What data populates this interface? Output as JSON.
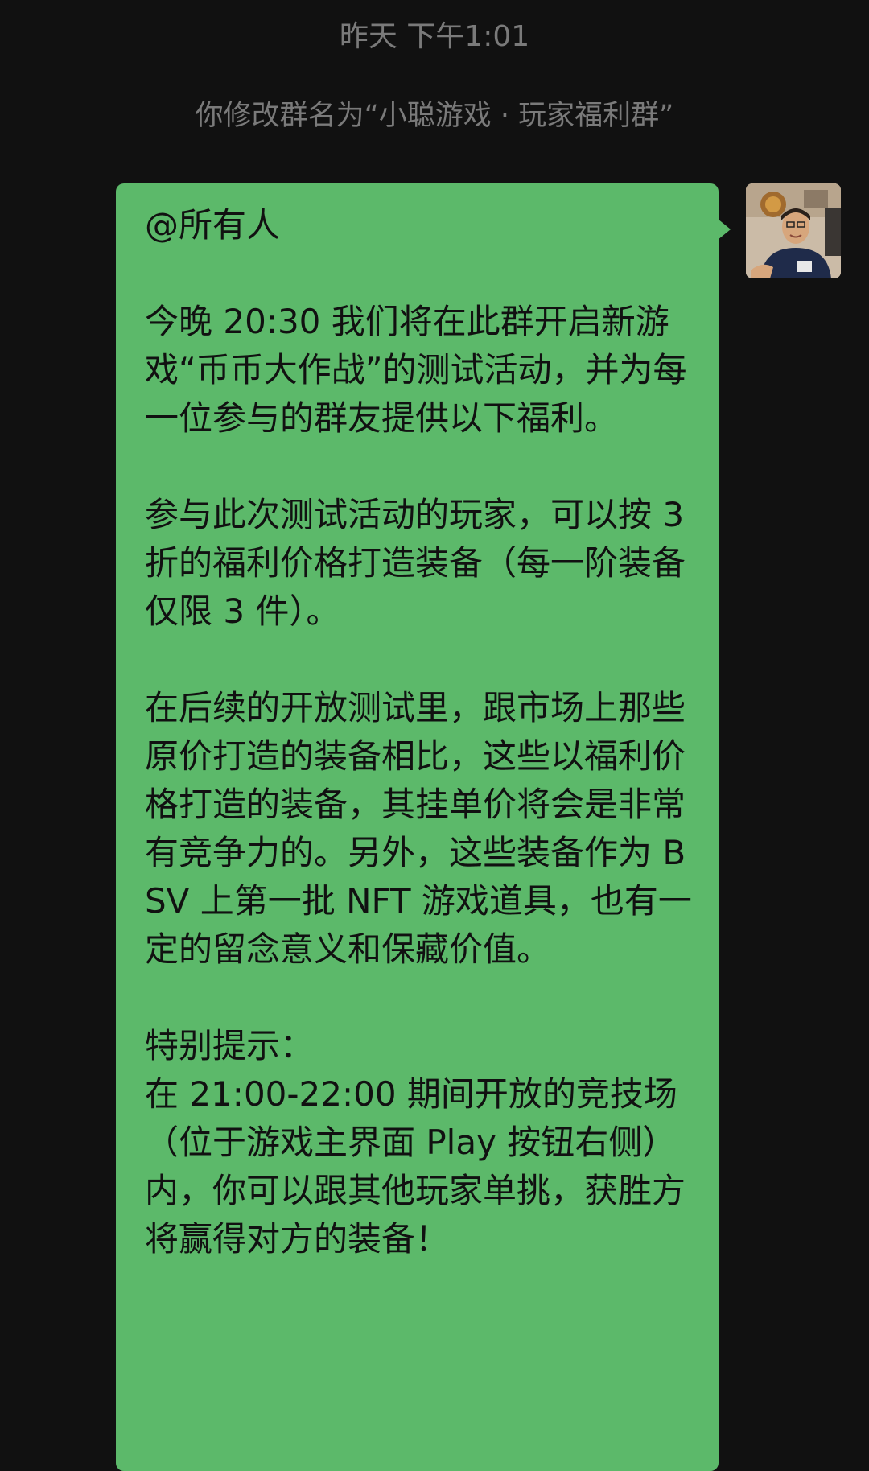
{
  "chat": {
    "timestamp": "昨天 下午1:01",
    "system_notice": "你修改群名为“小聪游戏 · 玩家福利群”",
    "message": {
      "paragraphs": [
        "@所有人",
        "今晚 20:30 我们将在此群开启新游戏“币币大作战”的测试活动，并为每一位参与的群友提供以下福利。",
        "参与此次测试活动的玩家，可以按 3 折的福利价格打造装备（每一阶装备仅限 3 件）。",
        "在后续的开放测试里，跟市场上那些原价打造的装备相比，这些以福利价格打造的装备，其挂单价将会是非常有竞争力的。另外，这些装备作为 BSV 上第一批 NFT 游戏道具，也有一定的留念意义和保藏价值。",
        "特别提示：\n在 21:00-22:00 期间开放的竞技场（位于游戏主界面 Play 按钮右侧）内，你可以跟其他玩家单挑，获胜方将赢得对方的装备！"
      ],
      "bubble_color": "#5cb96a",
      "sender_avatar": "user-avatar-photo"
    }
  },
  "colors": {
    "background": "#111111",
    "system_text": "#7a7a7a",
    "message_text": "#111111"
  }
}
